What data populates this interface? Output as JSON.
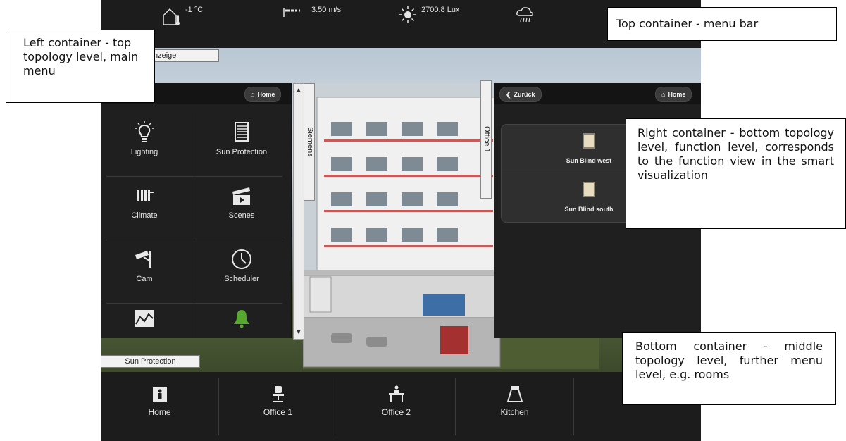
{
  "topbar": {
    "temperature": "-1 °C",
    "wind": "3.50 m/s",
    "light": "2700.8 Lux"
  },
  "scene": {
    "field_top": "nzeige",
    "field_bottom": "Sun Protection"
  },
  "left_panel": {
    "home_label": "Home",
    "items": [
      {
        "label": "Lighting",
        "icon": "lightbulb-icon"
      },
      {
        "label": "Sun Protection",
        "icon": "blind-icon"
      },
      {
        "label": "Climate",
        "icon": "radiator-icon"
      },
      {
        "label": "Scenes",
        "icon": "clapperboard-icon"
      },
      {
        "label": "Cam",
        "icon": "camera-icon"
      },
      {
        "label": "Scheduler",
        "icon": "clock-icon"
      },
      {
        "label": "",
        "icon": "chart-icon"
      },
      {
        "label": "",
        "icon": "bell-icon"
      }
    ]
  },
  "building_tabs": {
    "left": "Siemens",
    "right": "Office 1"
  },
  "right_panel": {
    "back_label": "Zurück",
    "home_label": "Home",
    "functions": [
      {
        "label": "Sun Blind west"
      },
      {
        "label": "Sun Blind south"
      }
    ]
  },
  "bottombar": {
    "items": [
      {
        "label": "Home",
        "icon": "home-icon"
      },
      {
        "label": "Office 1",
        "icon": "office-chair-icon"
      },
      {
        "label": "Office 2",
        "icon": "desk-icon"
      },
      {
        "label": "Kitchen",
        "icon": "coffee-pot-icon"
      }
    ]
  },
  "callouts": {
    "top": "Top container - menu bar",
    "left": "Left container - top topology level, main menu",
    "right": "Right container - bottom topology level, function level, corresponds to the function view in the smart visualization",
    "bottom": "Bottom container - middle topology level, further menu level, e.g. rooms"
  },
  "colors": {
    "panel": "#1f1f1f",
    "bar": "#1c1c1c",
    "accent_green": "#57a830"
  }
}
